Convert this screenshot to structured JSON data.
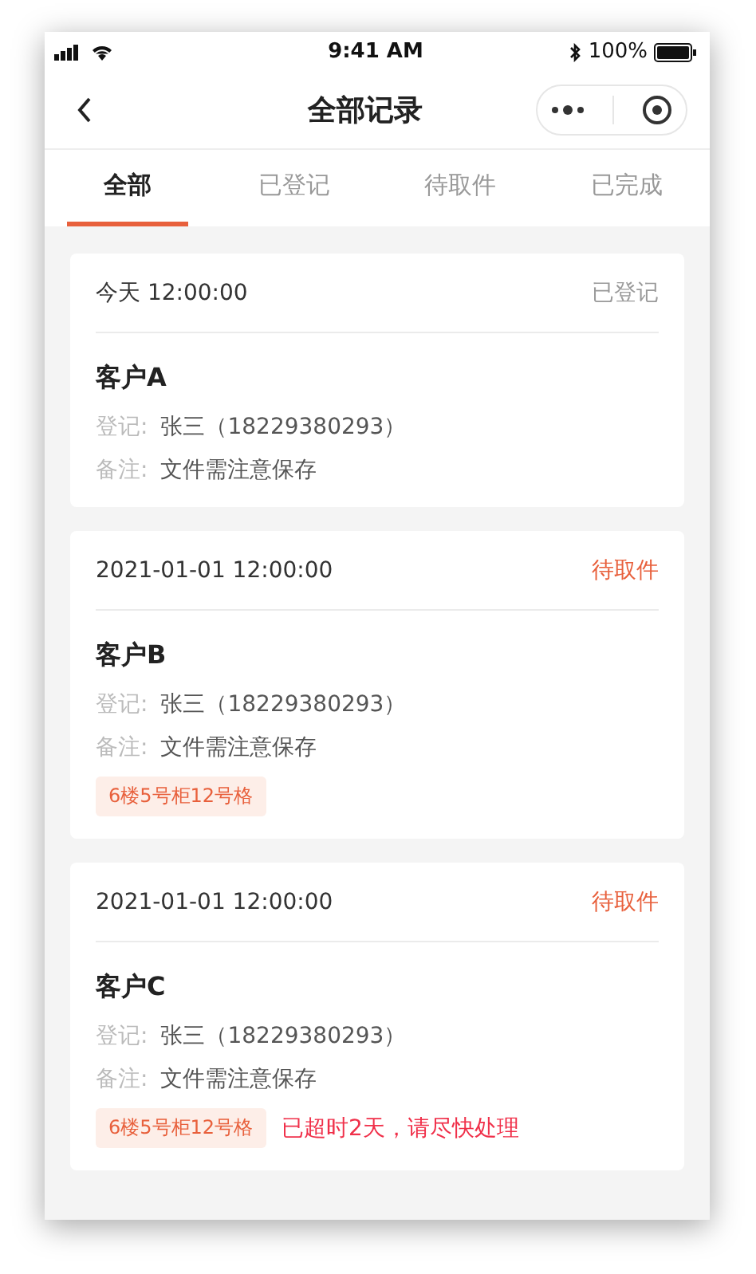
{
  "status_bar": {
    "time": "9:41 AM",
    "battery": "100%"
  },
  "nav": {
    "title": "全部记录"
  },
  "tabs": [
    {
      "label": "全部",
      "selected": true
    },
    {
      "label": "已登记",
      "selected": false
    },
    {
      "label": "待取件",
      "selected": false
    },
    {
      "label": "已完成",
      "selected": false
    }
  ],
  "records": [
    {
      "time": "今天 12:00:00",
      "status": "已登记",
      "color": "#9a9a9a",
      "customer": "客户A",
      "fields": [
        {
          "label": "登记:",
          "value": "张三（18229380293）"
        },
        {
          "label": "备注:",
          "value": "文件需注意保存"
        }
      ]
    },
    {
      "time": "2021-01-01 12:00:00",
      "status": "待取件",
      "color": "#e8603c",
      "customer": "客户B",
      "fields": [
        {
          "label": "登记:",
          "value": "张三（18229380293）"
        },
        {
          "label": "备注:",
          "value": "文件需注意保存"
        }
      ],
      "location": "6楼5号柜12号格"
    },
    {
      "time": "2021-01-01 12:00:00",
      "status": "待取件",
      "color": "#e8603c",
      "customer": "客户C",
      "fields": [
        {
          "label": "登记:",
          "value": "张三（18229380293）"
        },
        {
          "label": "备注:",
          "value": "文件需注意保存"
        }
      ],
      "location": "6楼5号柜12号格",
      "warning": "已超时2天，请尽快处理"
    }
  ]
}
